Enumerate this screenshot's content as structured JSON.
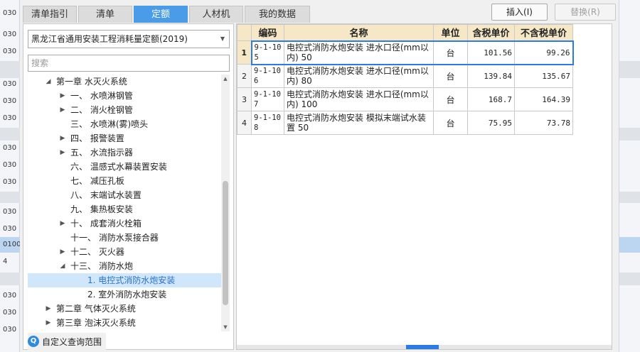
{
  "background": {
    "left_rows": [
      "030",
      "030",
      "030",
      "030",
      "030",
      "030",
      "030",
      "030",
      "030",
      "030",
      "030",
      "0100",
      "4",
      "030",
      "030",
      "030"
    ]
  },
  "tabs": [
    {
      "label": "清单指引",
      "active": false
    },
    {
      "label": "清单",
      "active": false
    },
    {
      "label": "定额",
      "active": true
    },
    {
      "label": "人材机",
      "active": false
    },
    {
      "label": "我的数据",
      "active": false
    }
  ],
  "buttons": {
    "insert": "插入(I)",
    "replace": "替换(R)"
  },
  "library_select": {
    "value": "黑龙江省通用安装工程消耗量定额(2019)"
  },
  "search": {
    "placeholder": "搜索"
  },
  "tree": [
    {
      "label": "第一章 水灭火系统",
      "toggle": "◢"
    },
    {
      "label": "一、  水喷淋钢管",
      "toggle": "▶"
    },
    {
      "label": "二、  消火栓钢管",
      "toggle": "▶"
    },
    {
      "label": "三、  水喷淋(雾)喷头",
      "toggle": ""
    },
    {
      "label": "四、  报警装置",
      "toggle": "▶"
    },
    {
      "label": "五、  水流指示器",
      "toggle": "▶"
    },
    {
      "label": "六、  温感式水幕装置安装",
      "toggle": ""
    },
    {
      "label": "七、  减压孔板",
      "toggle": ""
    },
    {
      "label": "八、  末端试水装置",
      "toggle": ""
    },
    {
      "label": "九、  集热板安装",
      "toggle": ""
    },
    {
      "label": "十、  成套消火栓箱",
      "toggle": "▶"
    },
    {
      "label": "十一、 消防水泵接合器",
      "toggle": ""
    },
    {
      "label": "十二、 灭火器",
      "toggle": "▶"
    },
    {
      "label": "十三、 消防水炮",
      "toggle": "◢"
    },
    {
      "label": "1. 电控式消防水炮安装",
      "toggle": ""
    },
    {
      "label": "2. 室外消防水炮安装",
      "toggle": ""
    },
    {
      "label": "第二章 气体灭火系统",
      "toggle": "▶"
    },
    {
      "label": "第三章 泡沫灭火系统",
      "toggle": "▶"
    }
  ],
  "custom_scope": {
    "label": "自定义查询范围",
    "icon": "search-icon"
  },
  "table": {
    "headers": [
      "编码",
      "名称",
      "单位",
      "含税单价",
      "不含税单价"
    ],
    "rows": [
      {
        "num": "1",
        "code": "9-1-105",
        "name": "电控式消防水炮安装 进水口径(mm以内) 50",
        "unit": "台",
        "price_tax": "101.56",
        "price_notax": "99.26"
      },
      {
        "num": "2",
        "code": "9-1-106",
        "name": "电控式消防水炮安装 进水口径(mm以内) 80",
        "unit": "台",
        "price_tax": "139.84",
        "price_notax": "135.67"
      },
      {
        "num": "3",
        "code": "9-1-107",
        "name": "电控式消防水炮安装 进水口径(mm以内) 100",
        "unit": "台",
        "price_tax": "168.7",
        "price_notax": "164.39"
      },
      {
        "num": "4",
        "code": "9-1-108",
        "name": "电控式消防水炮安装 模拟末端试水装置 50",
        "unit": "台",
        "price_tax": "75.95",
        "price_notax": "73.78"
      }
    ]
  },
  "colors": {
    "accent": "#4a9be8",
    "header_bg": "#f6e8c6",
    "selection": "#2c7be5"
  }
}
